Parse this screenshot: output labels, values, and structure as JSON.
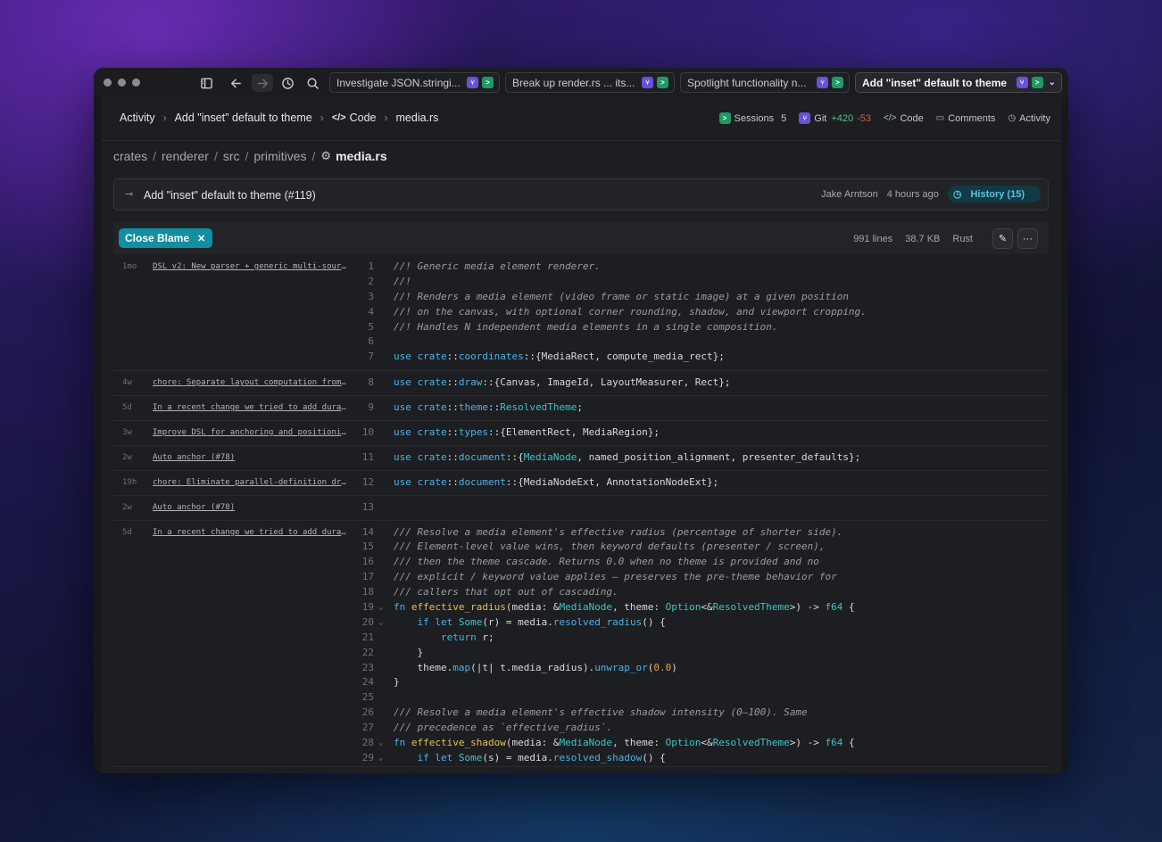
{
  "window": {
    "tabs": [
      {
        "label": "Investigate JSON.stringi...",
        "active": false
      },
      {
        "label": "Break up render.rs ... its...",
        "active": false
      },
      {
        "label": "Spotlight functionality n...",
        "active": false
      },
      {
        "label": "Add \"inset\" default to theme",
        "active": true
      }
    ]
  },
  "nav": {
    "crumbs": [
      "Activity",
      "Add \"inset\" default to theme",
      "Code",
      "media.rs"
    ],
    "sessions_label": "Sessions",
    "sessions_count": "5",
    "git_label": "Git",
    "git_plus": "+420",
    "git_minus": "-53",
    "code_label": "Code",
    "comments_label": "Comments",
    "activity_label": "Activity"
  },
  "path": {
    "segments": [
      "crates",
      "renderer",
      "src",
      "primitives"
    ],
    "file": "media.rs"
  },
  "commit": {
    "message": "Add \"inset\" default to theme (#119)",
    "author": "Jake Arntson",
    "time": "4 hours ago",
    "history_label": "History (15)"
  },
  "toolbar": {
    "close_blame_label": "Close Blame",
    "lines": "991 lines",
    "size": "38.7 KB",
    "language": "Rust"
  },
  "blame": [
    {
      "age": "1mo",
      "message": "DSL v2: New parser + generic multi-source..."
    },
    {
      "age": "4w",
      "message": "chore: Separate layout computation from..."
    },
    {
      "age": "5d",
      "message": "In a recent change we tried to add durations..."
    },
    {
      "age": "3w",
      "message": "Improve DSL for anchoring and positioning..."
    },
    {
      "age": "2w",
      "message": "Auto anchor (#78)"
    },
    {
      "age": "19h",
      "message": "chore: Eliminate parallel-definition drift..."
    },
    {
      "age": "2w",
      "message": "Auto anchor (#78)"
    },
    {
      "age": "5d",
      "message": "In a recent change we tried to add durations..."
    }
  ],
  "code_lines": [
    "//! Generic media element renderer.",
    "//!",
    "//! Renders a media element (video frame or static image) at a given position",
    "//! on the canvas, with optional corner rounding, shadow, and viewport cropping.",
    "//! Handles N independent media elements in a single composition.",
    "",
    "use crate::coordinates::{MediaRect, compute_media_rect};",
    "use crate::draw::{Canvas, ImageId, LayoutMeasurer, Rect};",
    "use crate::theme::ResolvedTheme;",
    "use crate::types::{ElementRect, MediaRegion};",
    "use crate::document::{MediaNode, named_position_alignment, presenter_defaults};",
    "use crate::document::{MediaNodeExt, AnnotationNodeExt};",
    "",
    "/// Resolve a media element's effective radius (percentage of shorter side).",
    "/// Element-level value wins, then keyword defaults (presenter / screen),",
    "/// then the theme cascade. Returns 0.0 when no theme is provided and no",
    "/// explicit / keyword value applies — preserves the pre-theme behavior for",
    "/// callers that opt out of cascading.",
    "fn effective_radius(media: &MediaNode, theme: Option<&ResolvedTheme>) -> f64 {",
    "    if let Some(r) = media.resolved_radius() {",
    "        return r;",
    "    }",
    "    theme.map(|t| t.media_radius).unwrap_or(0.0)",
    "}",
    "",
    "/// Resolve a media element's effective shadow intensity (0–100). Same",
    "/// precedence as `effective_radius`.",
    "fn effective_shadow(media: &MediaNode, theme: Option<&ResolvedTheme>) -> f64 {",
    "    if let Some(s) = media.resolved_shadow() {"
  ]
}
